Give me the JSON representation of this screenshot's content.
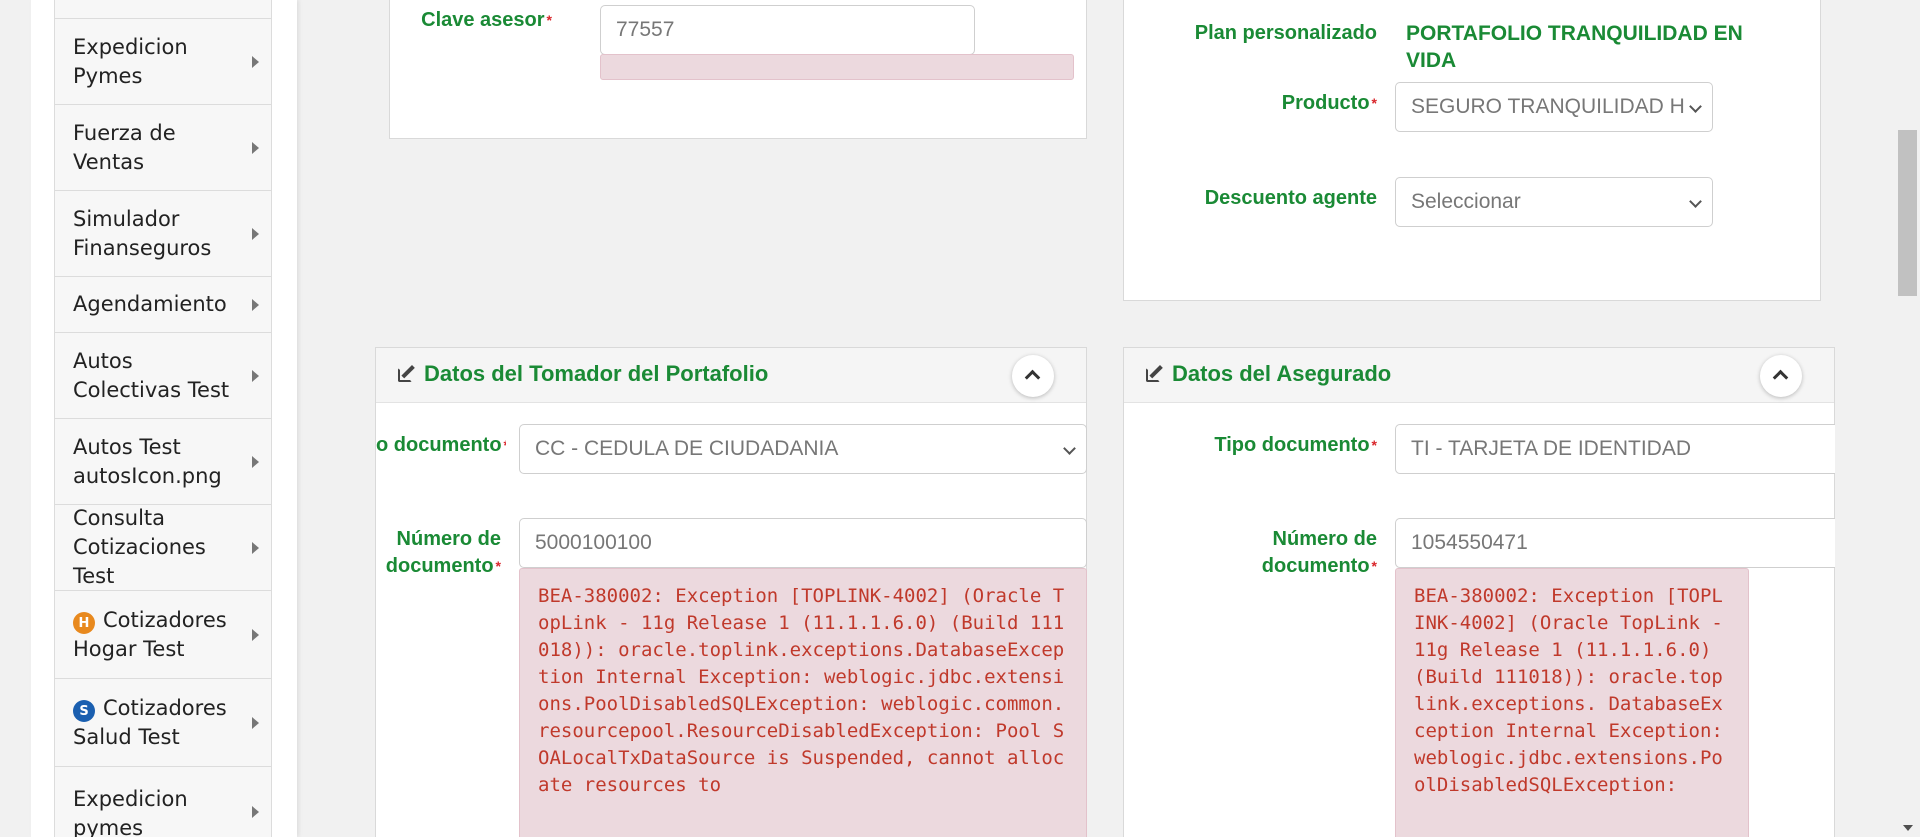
{
  "sidebar": {
    "items": [
      {
        "label": "",
        "icon": null
      },
      {
        "label": "Expedicion Pymes",
        "icon": null
      },
      {
        "label": "Fuerza de Ventas",
        "icon": null
      },
      {
        "label": "Simulador Finanseguros",
        "icon": null
      },
      {
        "label": "Agendamiento",
        "icon": null
      },
      {
        "label": "Autos Colectivas Test",
        "icon": null
      },
      {
        "label": "Autos Test autosIcon.png",
        "icon": null
      },
      {
        "label": "Consulta Cotizaciones Test",
        "icon": null
      },
      {
        "label": "Cotizadores Hogar Test",
        "icon": "H"
      },
      {
        "label": "Cotizadores Salud Test",
        "icon": "S"
      },
      {
        "label": "Expedicion pymes",
        "icon": null
      }
    ]
  },
  "asesor": {
    "label": "Clave asesor",
    "value": "77557"
  },
  "plan": {
    "plan_label": "Plan personalizado",
    "plan_value": "PORTAFOLIO TRANQUILIDAD EN VIDA",
    "producto_label": "Producto",
    "producto_value": "SEGURO TRANQUILIDAD H",
    "descuento_label": "Descuento agente",
    "descuento_value": "Seleccionar"
  },
  "tomador": {
    "title": "Datos del Tomador del Portafolio",
    "tipo_label": "o documento",
    "tipo_value": "CC - CEDULA DE CIUDADANIA",
    "numero_label_1": "Número de",
    "numero_label_2": "documento",
    "numero_value": "5000100100",
    "error": "BEA-380002: Exception [TOPLINK-4002] (Oracle TopLink - 11g Release 1 (11.1.1.6.0) (Build 111018)): oracle.toplink.exceptions.DatabaseException Internal Exception: weblogic.jdbc.extensions.PoolDisabledSQLException: weblogic.common.resourcepool.ResourceDisabledException: Pool SOALocalTxDataSource is Suspended, cannot allocate resources to"
  },
  "asegurado": {
    "title": "Datos del Asegurado",
    "tipo_label": "Tipo documento",
    "tipo_value": "TI - TARJETA DE IDENTIDAD",
    "numero_label_1": "Número de",
    "numero_label_2": "documento",
    "numero_value": "1054550471",
    "error": "BEA-380002: Exception [TOPLINK-4002] (Oracle TopLink - 11g Release 1 (11.1.1.6.0) (Build 111018)): oracle.toplink.exceptions. DatabaseException Internal Exception: weblogic.jdbc.extensions.PoolDisabledSQLException:"
  },
  "colors": {
    "accent_green": "#1a8a35",
    "required_red": "#d9262b",
    "error_bg": "#ecd9de",
    "error_text": "#c0392b",
    "badge_hogar": "#e8891e",
    "badge_salud": "#1a5fb0"
  }
}
